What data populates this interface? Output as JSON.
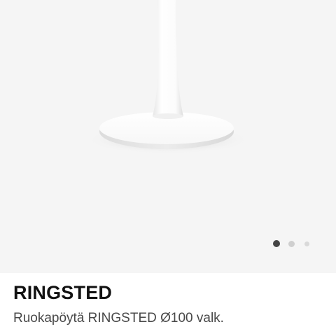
{
  "product": {
    "name": "RINGSTED",
    "description": "Ruokapöytä RINGSTED Ø100 valk."
  },
  "gallery": {
    "image_subject": "white-pedestal-table-base",
    "current_index": 1,
    "total_images": 3,
    "dot_colors": {
      "active": "#444444",
      "inactive": "#cfcfcf",
      "inactive_small": "#d9d9d9"
    }
  },
  "colors": {
    "image_background": "#f5f5f5",
    "page_background": "#ffffff",
    "title": "#111111",
    "description": "#484848"
  }
}
